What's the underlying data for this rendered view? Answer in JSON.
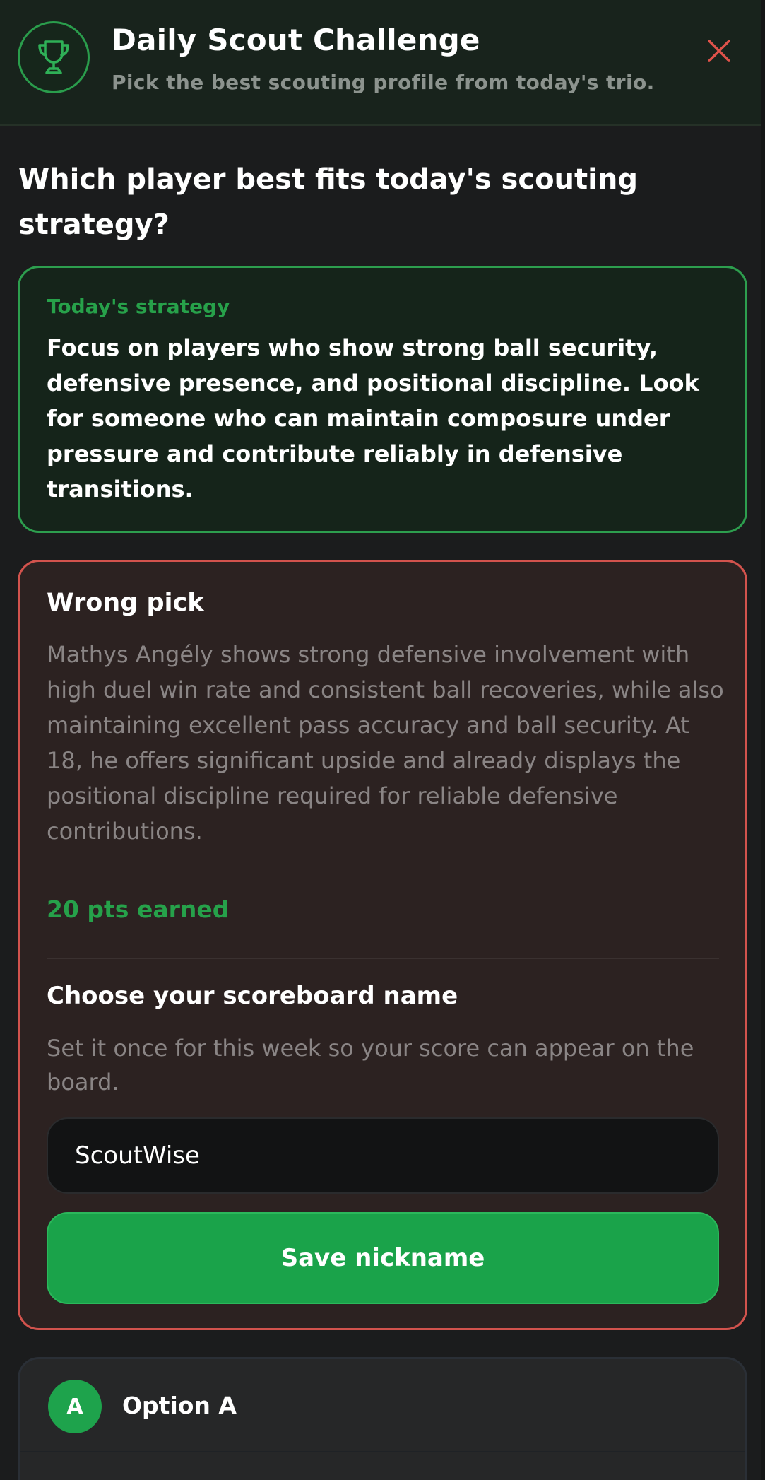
{
  "header": {
    "title": "Daily Scout Challenge",
    "subtitle": "Pick the best scouting profile from today's trio.",
    "icon": "trophy-icon",
    "close_icon": "close-icon"
  },
  "question": "Which player best fits today's scouting strategy?",
  "strategy": {
    "label": "Today's strategy",
    "text": "Focus on players who show strong ball security, defensive presence, and positional discipline. Look for someone who can maintain composure under pressure and contribute reliably in defensive transitions."
  },
  "result": {
    "title": "Wrong pick",
    "explanation": "Mathys Angély shows strong defensive involvement with high duel win rate and consistent ball recoveries, while also maintaining excellent pass accuracy and ball security. At 18, he offers significant upside and already displays the positional discipline required for reliable defensive contributions.",
    "points": "20 pts earned"
  },
  "scoreboard": {
    "title": "Choose your scoreboard name",
    "description": "Set it once for this week so your score can appear on the board.",
    "input_value": "ScoutWise",
    "save_label": "Save nickname"
  },
  "option_a": {
    "badge": "A",
    "label": "Option A"
  },
  "colors": {
    "accent_green": "#1aa34a",
    "error_red": "#d2534d",
    "background": "#1b1c1d"
  }
}
